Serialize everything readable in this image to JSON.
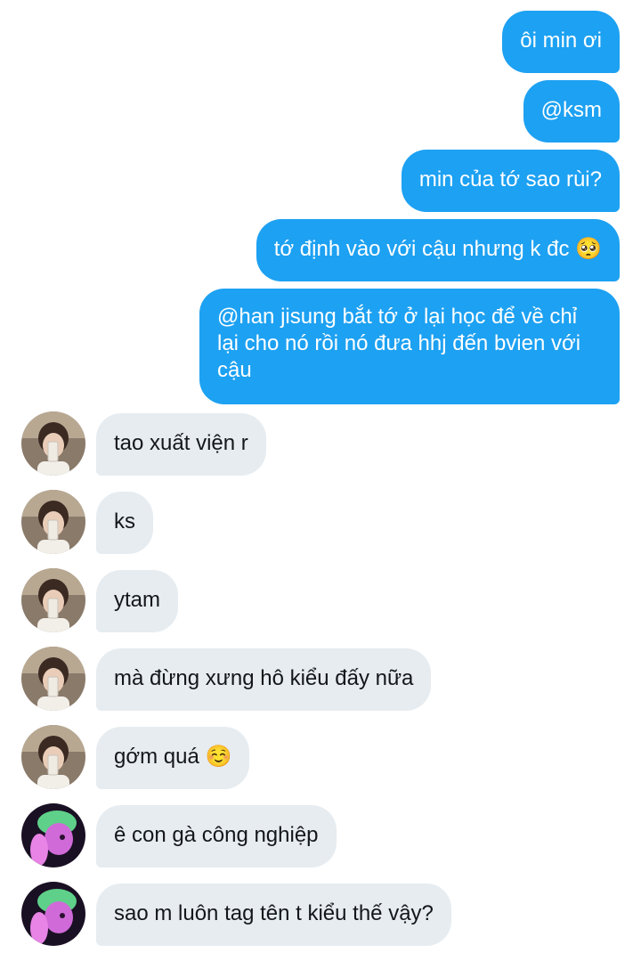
{
  "messages": [
    {
      "from": "me",
      "text": "ôi min ơi"
    },
    {
      "from": "me",
      "text": "@ksm"
    },
    {
      "from": "me",
      "text": "min của tớ sao rùi?"
    },
    {
      "from": "me",
      "text": "tớ định vào với cậu nhưng k đc 🥺"
    },
    {
      "from": "me",
      "text": "@han jisung bắt tớ ở lại học để về chỉ lại cho nó rồi nó đưa hhj đến bvien với cậu"
    },
    {
      "from": "ksm",
      "text": "tao xuất viện r"
    },
    {
      "from": "ksm",
      "text": "ks"
    },
    {
      "from": "ksm",
      "text": "ytam"
    },
    {
      "from": "ksm",
      "text": "mà đừng xưng hô kiểu đấy nữa"
    },
    {
      "from": "ksm",
      "text": "gớm quá ☺️"
    },
    {
      "from": "other",
      "text": "ê con gà công nghiệp"
    },
    {
      "from": "other",
      "text": "sao m luôn tag tên t kiểu thế vậy?"
    }
  ],
  "colors": {
    "outgoing_bubble": "#1da1f2",
    "incoming_bubble": "#e6ecf0"
  },
  "icons": {
    "avatar_ksm": "selfie-avatar-icon",
    "avatar_other": "green-hair-avatar-icon"
  }
}
